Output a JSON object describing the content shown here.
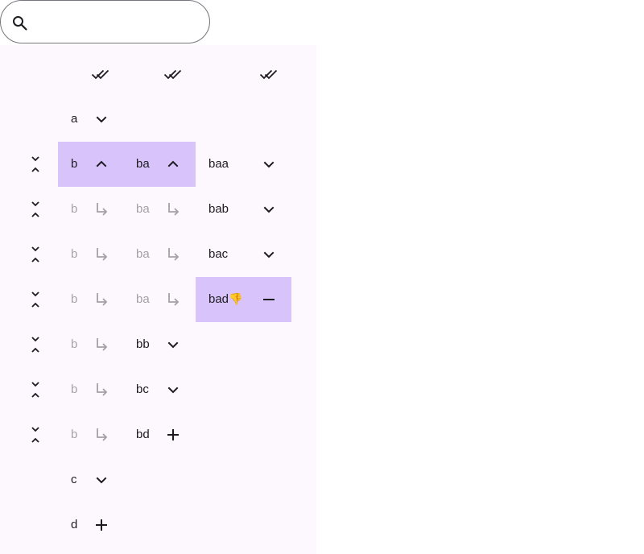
{
  "search": {
    "value": "",
    "placeholder": ""
  },
  "columns": {
    "check_icons": [
      "double-check-icon",
      "double-check-icon",
      "double-check-icon"
    ]
  },
  "rows": [
    {
      "col1": "a",
      "col1_icon": "chevron-down"
    },
    {
      "col1": "b",
      "col1_icon": "chevron-up",
      "col2": "ba",
      "col2_icon": "chevron-up",
      "col3": "baa",
      "col3_icon": "chevron-down",
      "collapse": true
    },
    {
      "col1": "b",
      "col1_dim": true,
      "col2": "ba",
      "col2_dim": true,
      "col3": "bab",
      "col3_icon": "chevron-down",
      "collapse": true
    },
    {
      "col1": "b",
      "col1_dim": true,
      "col2": "ba",
      "col2_dim": true,
      "col3": "bac",
      "col3_icon": "chevron-down",
      "collapse": true
    },
    {
      "col1": "b",
      "col1_dim": true,
      "col2": "ba",
      "col2_dim": true,
      "col3": "bad",
      "col3_suffix": "👎",
      "col3_icon": "minus",
      "collapse": true
    },
    {
      "col1": "b",
      "col1_dim": true,
      "col2": "bb",
      "col2_icon": "chevron-down",
      "collapse": true
    },
    {
      "col1": "b",
      "col1_dim": true,
      "col2": "bc",
      "col2_icon": "chevron-down",
      "collapse": true
    },
    {
      "col1": "b",
      "col1_dim": true,
      "col2": "bd",
      "col2_icon": "plus",
      "collapse": true
    },
    {
      "col1": "c",
      "col1_icon": "chevron-down"
    },
    {
      "col1": "d",
      "col1_icon": "plus"
    }
  ]
}
